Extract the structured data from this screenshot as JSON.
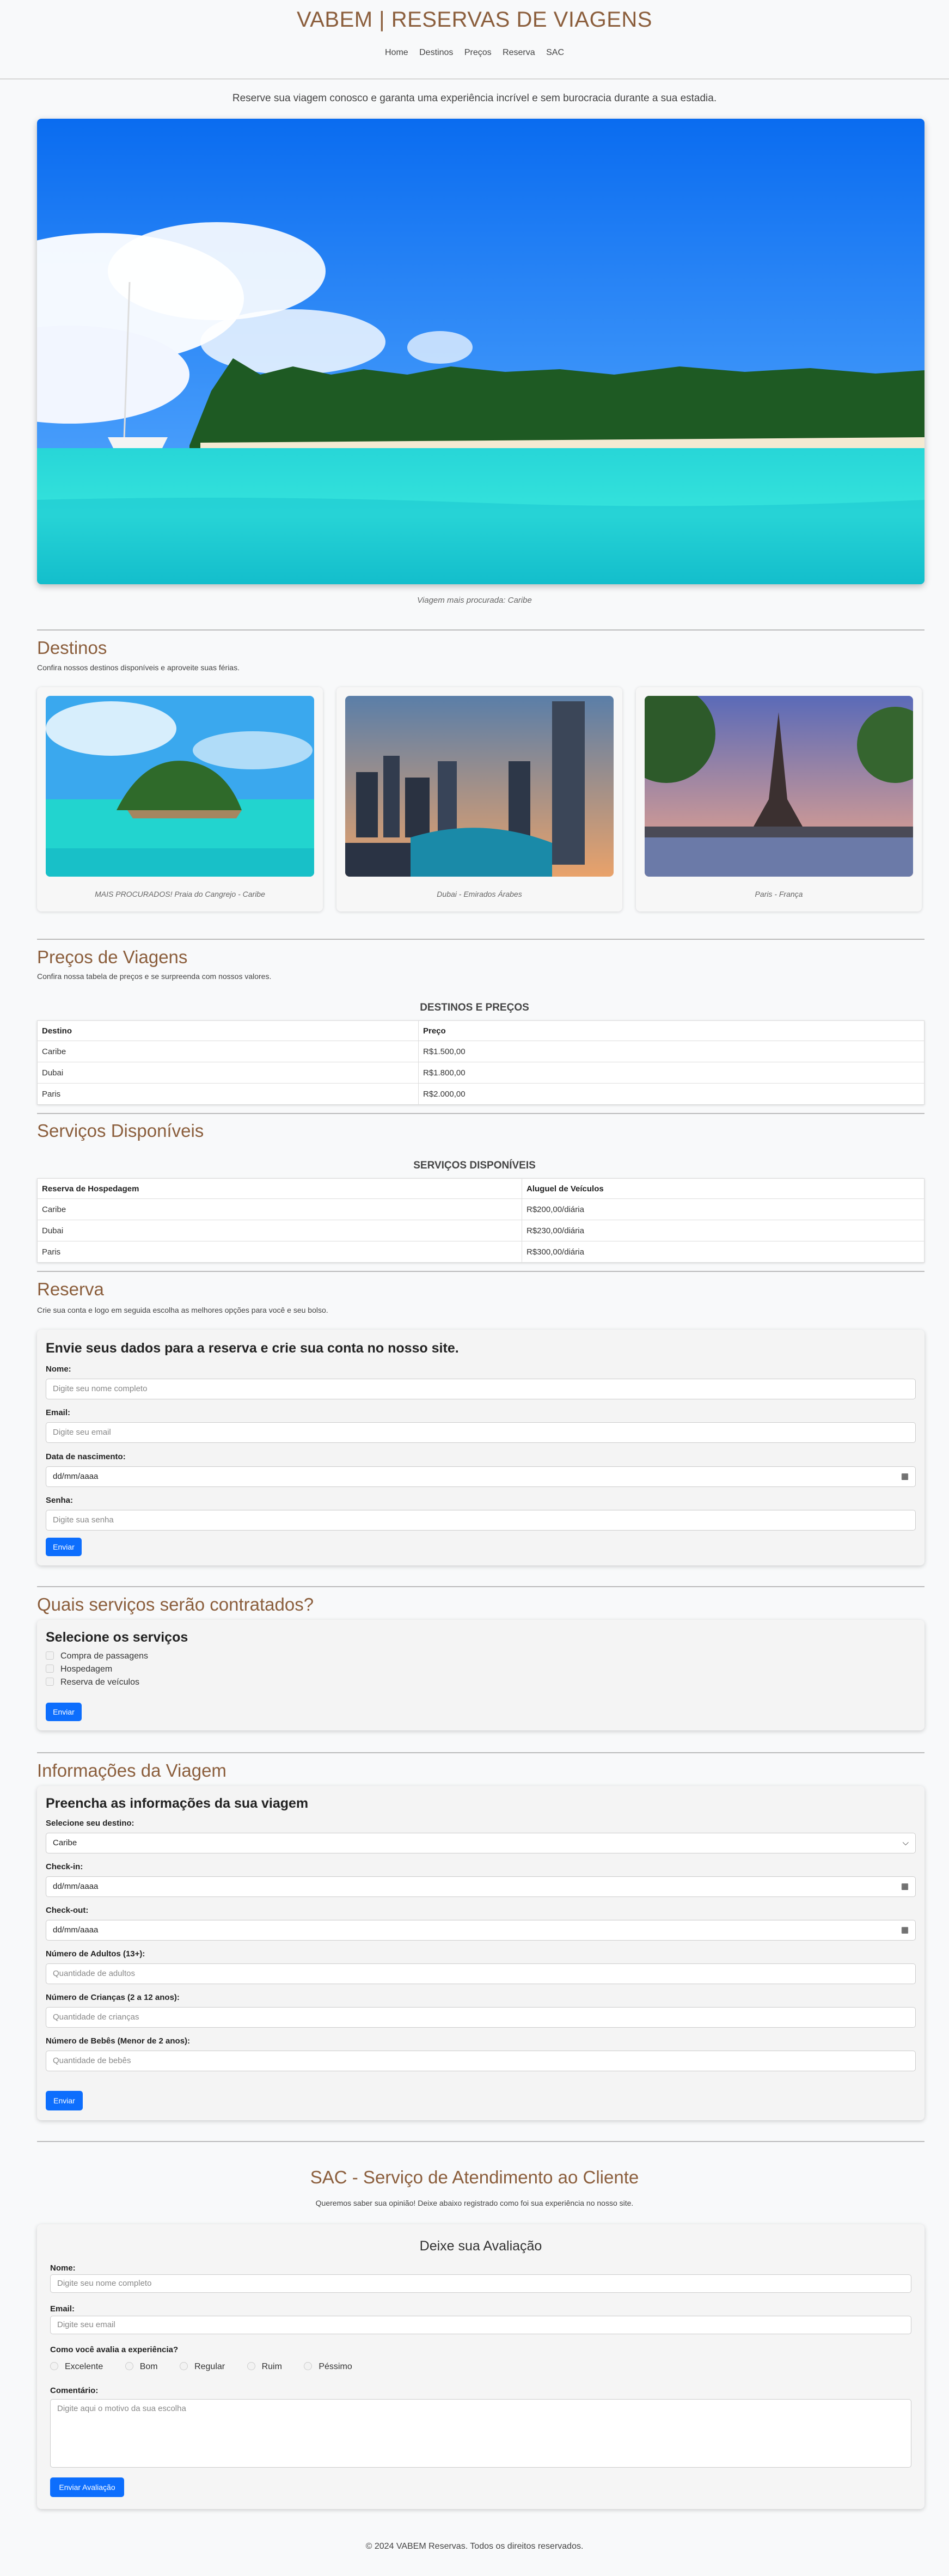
{
  "header": {
    "title": "VABEM | RESERVAS DE VIAGENS",
    "nav": [
      "Home",
      "Destinos",
      "Preços",
      "Reserva",
      "SAC"
    ]
  },
  "intro": "Reserve sua viagem conosco e garanta uma experiência incrível e sem burocracia durante a sua estadia.",
  "hero": {
    "caption": "Viagem mais procurada: Caribe"
  },
  "destinos": {
    "title": "Destinos",
    "subtitle": "Confira nossos destinos disponíveis e aproveite suas férias.",
    "cards": [
      {
        "caption": "MAIS PROCURADOS! Praia do Cangrejo - Caribe"
      },
      {
        "caption": "Dubai - Emirados Árabes"
      },
      {
        "caption": "Paris - França"
      }
    ]
  },
  "precos": {
    "title": "Preços de Viagens",
    "subtitle": "Confira nossa tabela de preços e se surpreenda com nossos valores.",
    "table_title": "DESTINOS E PREÇOS",
    "headers": [
      "Destino",
      "Preço"
    ],
    "rows": [
      [
        "Caribe",
        "R$1.500,00"
      ],
      [
        "Dubai",
        "R$1.800,00"
      ],
      [
        "Paris",
        "R$2.000,00"
      ]
    ]
  },
  "servicos": {
    "title": "Serviços Disponíveis",
    "table_title": "SERVIÇOS DISPONÍVEIS",
    "headers": [
      "Reserva de Hospedagem",
      "Aluguel de Veículos"
    ],
    "rows": [
      [
        "Caribe",
        "R$200,00/diária"
      ],
      [
        "Dubai",
        "R$230,00/diária"
      ],
      [
        "Paris",
        "R$300,00/diária"
      ]
    ]
  },
  "reserva": {
    "title": "Reserva",
    "subtitle": "Crie sua conta e logo em seguida escolha as melhores opções para você e seu bolso.",
    "form_title": "Envie seus dados para a reserva e crie sua conta no nosso site.",
    "name_label": "Nome:",
    "name_placeholder": "Digite seu nome completo",
    "email_label": "Email:",
    "email_placeholder": "Digite seu email",
    "birth_label": "Data de nascimento:",
    "birth_value": "dd/mm/aaaa",
    "password_label": "Senha:",
    "password_placeholder": "Digite sua senha",
    "submit": "Enviar"
  },
  "contratados": {
    "title": "Quais serviços serão contratados?",
    "form_title": "Selecione os serviços",
    "options": [
      "Compra de passagens",
      "Hospedagem",
      "Reserva de veículos"
    ],
    "submit": "Enviar"
  },
  "informacoes": {
    "title": "Informações da Viagem",
    "form_title": "Preencha as informações da sua viagem",
    "destino_label": "Selecione seu destino:",
    "destino_value": "Caribe",
    "checkin_label": "Check-in:",
    "checkin_value": "dd/mm/aaaa",
    "checkout_label": "Check-out:",
    "checkout_value": "dd/mm/aaaa",
    "adultos_label": "Número de Adultos (13+):",
    "adultos_placeholder": "Quantidade de adultos",
    "criancas_label": "Número de Crianças (2 a 12 anos):",
    "criancas_placeholder": "Quantidade de crianças",
    "bebes_label": "Número de Bebês (Menor de 2 anos):",
    "bebes_placeholder": "Quantidade de bebês",
    "submit": "Enviar"
  },
  "sac": {
    "title": "SAC - Serviço de Atendimento ao Cliente",
    "subtitle": "Queremos saber sua opinião! Deixe abaixo registrado como foi sua experiência no nosso site.",
    "form_title": "Deixe sua Avaliação",
    "name_label": "Nome:",
    "name_placeholder": "Digite seu nome completo",
    "email_label": "Email:",
    "email_placeholder": "Digite seu email",
    "rating_label": "Como você avalia a experiência?",
    "ratings": [
      "Excelente",
      "Bom",
      "Regular",
      "Ruim",
      "Péssimo"
    ],
    "comment_label": "Comentário:",
    "comment_placeholder": "Digite aqui o motivo da sua escolha",
    "submit": "Enviar Avaliação"
  },
  "footer": "© 2024 VABEM Reservas. Todos os direitos reservados."
}
